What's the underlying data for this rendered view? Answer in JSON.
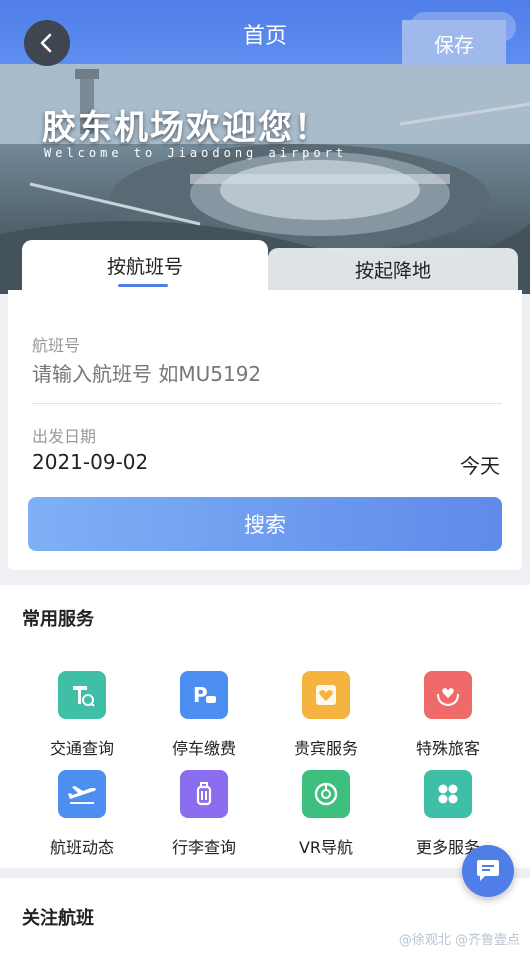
{
  "header": {
    "title": "首页",
    "save_label": "保存"
  },
  "banner": {
    "title": "胶东机场欢迎您！",
    "subtitle": "Welcome to Jiaodong airport"
  },
  "search": {
    "tabs": [
      {
        "label": "按航班号",
        "active": true
      },
      {
        "label": "按起降地",
        "active": false
      }
    ],
    "flight_label": "航班号",
    "flight_placeholder": "请输入航班号 如MU5192",
    "date_label": "出发日期",
    "date_value": "2021-09-02",
    "date_tag": "今天",
    "button_label": "搜索"
  },
  "services": {
    "title": "常用服务",
    "items": [
      {
        "label": "交通查询",
        "icon": "traffic-sign-icon",
        "color": "#3fbfa6"
      },
      {
        "label": "停车缴费",
        "icon": "parking-icon",
        "color": "#4d8ff0"
      },
      {
        "label": "贵宾服务",
        "icon": "vip-heart-icon",
        "color": "#f5b43f"
      },
      {
        "label": "特殊旅客",
        "icon": "heart-hands-icon",
        "color": "#f06a6a"
      },
      {
        "label": "航班动态",
        "icon": "plane-icon",
        "color": "#4d8ff0"
      },
      {
        "label": "行李查询",
        "icon": "luggage-icon",
        "color": "#8b6ef0"
      },
      {
        "label": "VR导航",
        "icon": "compass-icon",
        "color": "#3dbf80"
      },
      {
        "label": "更多服务",
        "icon": "more-grid-icon",
        "color": "#3fbfa6"
      }
    ]
  },
  "follow": {
    "title": "关注航班"
  },
  "watermark": "@徐观北 @齐鲁壹点",
  "colors": {
    "primary": "#4f7ee8",
    "button_gradient_start": "#7fb0f6",
    "button_gradient_end": "#5f8ae9"
  }
}
